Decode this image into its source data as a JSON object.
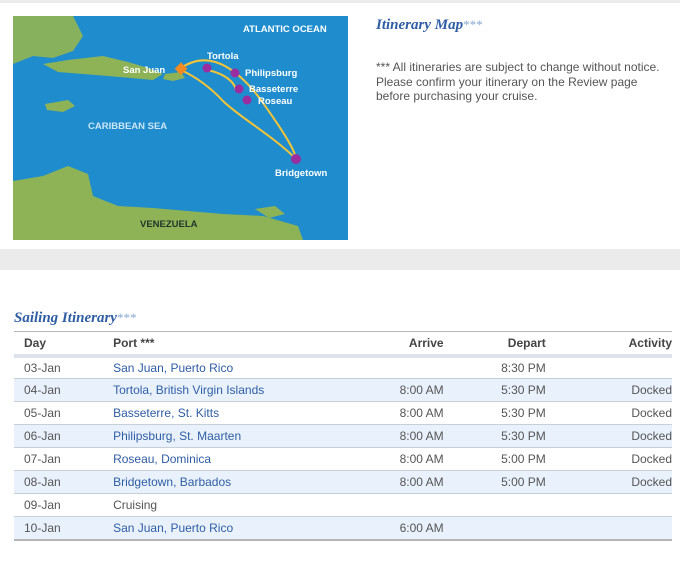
{
  "map": {
    "labels": {
      "ocean": "ATLANTIC OCEAN",
      "sea": "CARIBBEAN SEA",
      "country": "VENEZUELA",
      "san_juan": "San Juan",
      "tortola": "Tortola",
      "philipsburg": "Philipsburg",
      "basseterre": "Basseterre",
      "roseau": "Roseau",
      "bridgetown": "Bridgetown"
    },
    "colors": {
      "water": "#1e8ccd",
      "land": "#8eb356",
      "route": "#f2c43a",
      "port": "#9a2ea0",
      "home_port": "#f28a21"
    }
  },
  "itinerary_map": {
    "title": "Itinerary Map",
    "stars": "***",
    "notice": "*** All itineraries are subject to change without notice. Please confirm your itinerary on the Review page before purchasing your cruise."
  },
  "sailing": {
    "title": "Sailing Itinerary",
    "stars": "***",
    "headers": {
      "day": "Day",
      "port": "Port ***",
      "arrive": "Arrive",
      "depart": "Depart",
      "activity": "Activity"
    },
    "rows": [
      {
        "day": "03-Jan",
        "port": "San Juan, Puerto Rico",
        "arrive": "",
        "depart": "8:30 PM",
        "activity": ""
      },
      {
        "day": "04-Jan",
        "port": "Tortola, British Virgin Islands",
        "arrive": "8:00 AM",
        "depart": "5:30 PM",
        "activity": "Docked"
      },
      {
        "day": "05-Jan",
        "port": "Basseterre, St. Kitts",
        "arrive": "8:00 AM",
        "depart": "5:30 PM",
        "activity": "Docked"
      },
      {
        "day": "06-Jan",
        "port": "Philipsburg, St. Maarten",
        "arrive": "8:00 AM",
        "depart": "5:30 PM",
        "activity": "Docked"
      },
      {
        "day": "07-Jan",
        "port": "Roseau, Dominica",
        "arrive": "8:00 AM",
        "depart": "5:00 PM",
        "activity": "Docked"
      },
      {
        "day": "08-Jan",
        "port": "Bridgetown, Barbados",
        "arrive": "8:00 AM",
        "depart": "5:00 PM",
        "activity": "Docked"
      },
      {
        "day": "09-Jan",
        "port": "Cruising",
        "arrive": "",
        "depart": "",
        "activity": ""
      },
      {
        "day": "10-Jan",
        "port": "San Juan, Puerto Rico",
        "arrive": "6:00 AM",
        "depart": "",
        "activity": ""
      }
    ]
  }
}
